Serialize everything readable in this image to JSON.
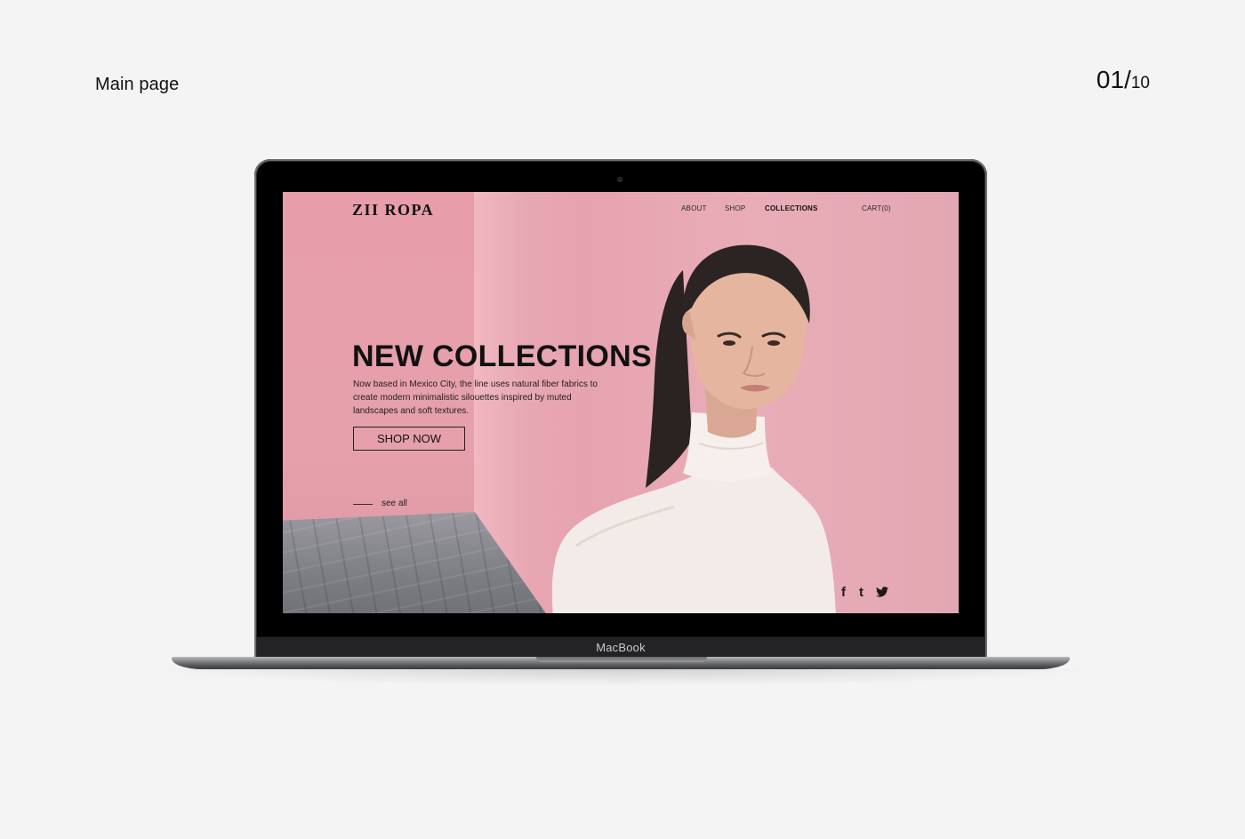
{
  "slide": {
    "title": "Main page",
    "current": "01",
    "separator": "/",
    "total": "10"
  },
  "device": {
    "brand_label": "MacBook"
  },
  "site": {
    "logo": "ZII ROPA",
    "nav": [
      "ABOUT",
      "SHOP",
      "COLLECTIONS",
      "CART(0)"
    ],
    "active_nav": "COLLECTIONS",
    "hero": {
      "title": "NEW COLLECTIONS",
      "description": "Now based in Mexico City, the line uses natural fiber fabrics to create modern minimalistic silouettes inspired by muted landscapes and soft textures.",
      "button_label": "SHOP NOW",
      "see_all_label": "see all"
    },
    "social": {
      "facebook": "f",
      "tumblr": "t",
      "twitter": "twitter-bird"
    }
  },
  "colors": {
    "background": "#f4f4f4",
    "hero_pink": "#e8aab5",
    "text": "#111111"
  }
}
